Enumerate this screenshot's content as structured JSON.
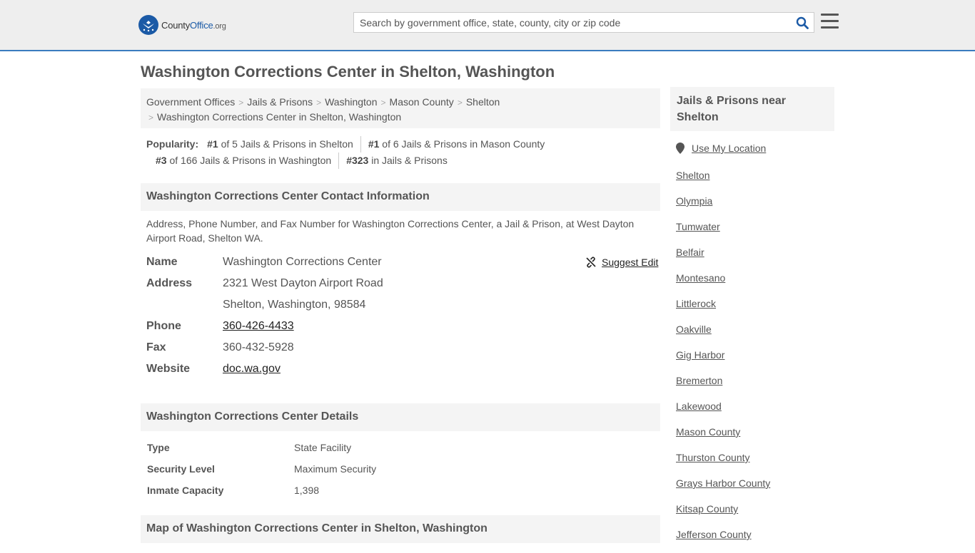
{
  "header": {
    "logo_name": "County",
    "logo_brand": "Office",
    "logo_tld": ".org",
    "search_placeholder": "Search by government office, state, county, city or zip code"
  },
  "page_title": "Washington Corrections Center in Shelton, Washington",
  "breadcrumbs": [
    "Government Offices",
    "Jails & Prisons",
    "Washington",
    "Mason County",
    "Shelton",
    "Washington Corrections Center in Shelton, Washington"
  ],
  "popularity": {
    "label": "Popularity:",
    "items": [
      {
        "rank": "#1",
        "text": " of 5 Jails & Prisons in Shelton"
      },
      {
        "rank": "#1",
        "text": " of 6 Jails & Prisons in Mason County"
      },
      {
        "rank": "#3",
        "text": " of 166 Jails & Prisons in Washington"
      },
      {
        "rank": "#323",
        "text": " in Jails & Prisons"
      }
    ]
  },
  "contact_section": {
    "heading": "Washington Corrections Center Contact Information",
    "description": "Address, Phone Number, and Fax Number for Washington Corrections Center, a Jail & Prison, at West Dayton Airport Road, Shelton WA.",
    "suggest_edit": "Suggest Edit",
    "name_label": "Name",
    "name": "Washington Corrections Center",
    "address_label": "Address",
    "address_line1": "2321 West Dayton Airport Road",
    "address_line2": "Shelton, Washington, 98584",
    "phone_label": "Phone",
    "phone": "360-426-4433",
    "fax_label": "Fax",
    "fax": "360-432-5928",
    "website_label": "Website",
    "website": "doc.wa.gov"
  },
  "details_section": {
    "heading": "Washington Corrections Center Details",
    "rows": [
      {
        "label": "Type",
        "value": "State Facility"
      },
      {
        "label": "Security Level",
        "value": "Maximum Security"
      },
      {
        "label": "Inmate Capacity",
        "value": "1,398"
      }
    ]
  },
  "map_section": {
    "heading": "Map of Washington Corrections Center in Shelton, Washington"
  },
  "sidebar": {
    "heading": "Jails & Prisons near Shelton",
    "use_location": "Use My Location",
    "links": [
      "Shelton",
      "Olympia",
      "Tumwater",
      "Belfair",
      "Montesano",
      "Littlerock",
      "Oakville",
      "Gig Harbor",
      "Bremerton",
      "Lakewood",
      "Mason County",
      "Thurston County",
      "Grays Harbor County",
      "Kitsap County",
      "Jefferson County"
    ]
  },
  "colors": {
    "accent": "#3a7cbf",
    "brand": "#1b5aa6",
    "panel": "#f4f4f4"
  }
}
